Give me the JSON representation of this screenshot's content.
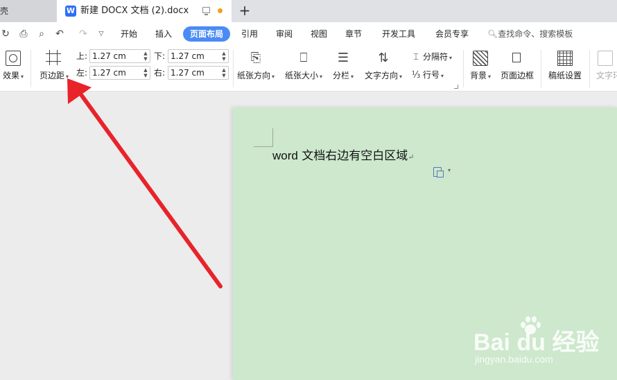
{
  "tabs": {
    "prev_label": "壳",
    "active_label": "新建 DOCX 文档 (2).docx",
    "app_badge": "W",
    "new_tab": "+"
  },
  "menu": {
    "tabs": [
      "开始",
      "插入",
      "页面布局",
      "引用",
      "审阅",
      "视图",
      "章节",
      "开发工具",
      "会员专享"
    ],
    "active_tab": "页面布局",
    "search_label": "查找命令、搜索模板"
  },
  "ribbon": {
    "effects_label": "效果",
    "margins_label": "页边距",
    "margin_top_label": "上:",
    "margin_top_value": "1.27 cm",
    "margin_bottom_label": "下:",
    "margin_bottom_value": "1.27 cm",
    "margin_left_label": "左:",
    "margin_left_value": "1.27 cm",
    "margin_right_label": "右:",
    "margin_right_value": "1.27 cm",
    "orientation_label": "纸张方向",
    "size_label": "纸张大小",
    "columns_label": "分栏",
    "text_direction_label": "文字方向",
    "separator_label": "分隔符",
    "line_number_label": "行号",
    "background_label": "背景",
    "page_border_label": "页面边框",
    "manuscript_label": "稿纸设置",
    "text_wrap_label": "文字环"
  },
  "document": {
    "text_latin": "word",
    "text_cjk": " 文档右边有空白区域",
    "para_mark": "↵",
    "page_color": "#cde8cd"
  },
  "annotation": {
    "arrow_color": "#e8232a"
  },
  "watermark": {
    "brand": "Bai  du 经验",
    "sub": "jingyan.baidu.com"
  }
}
